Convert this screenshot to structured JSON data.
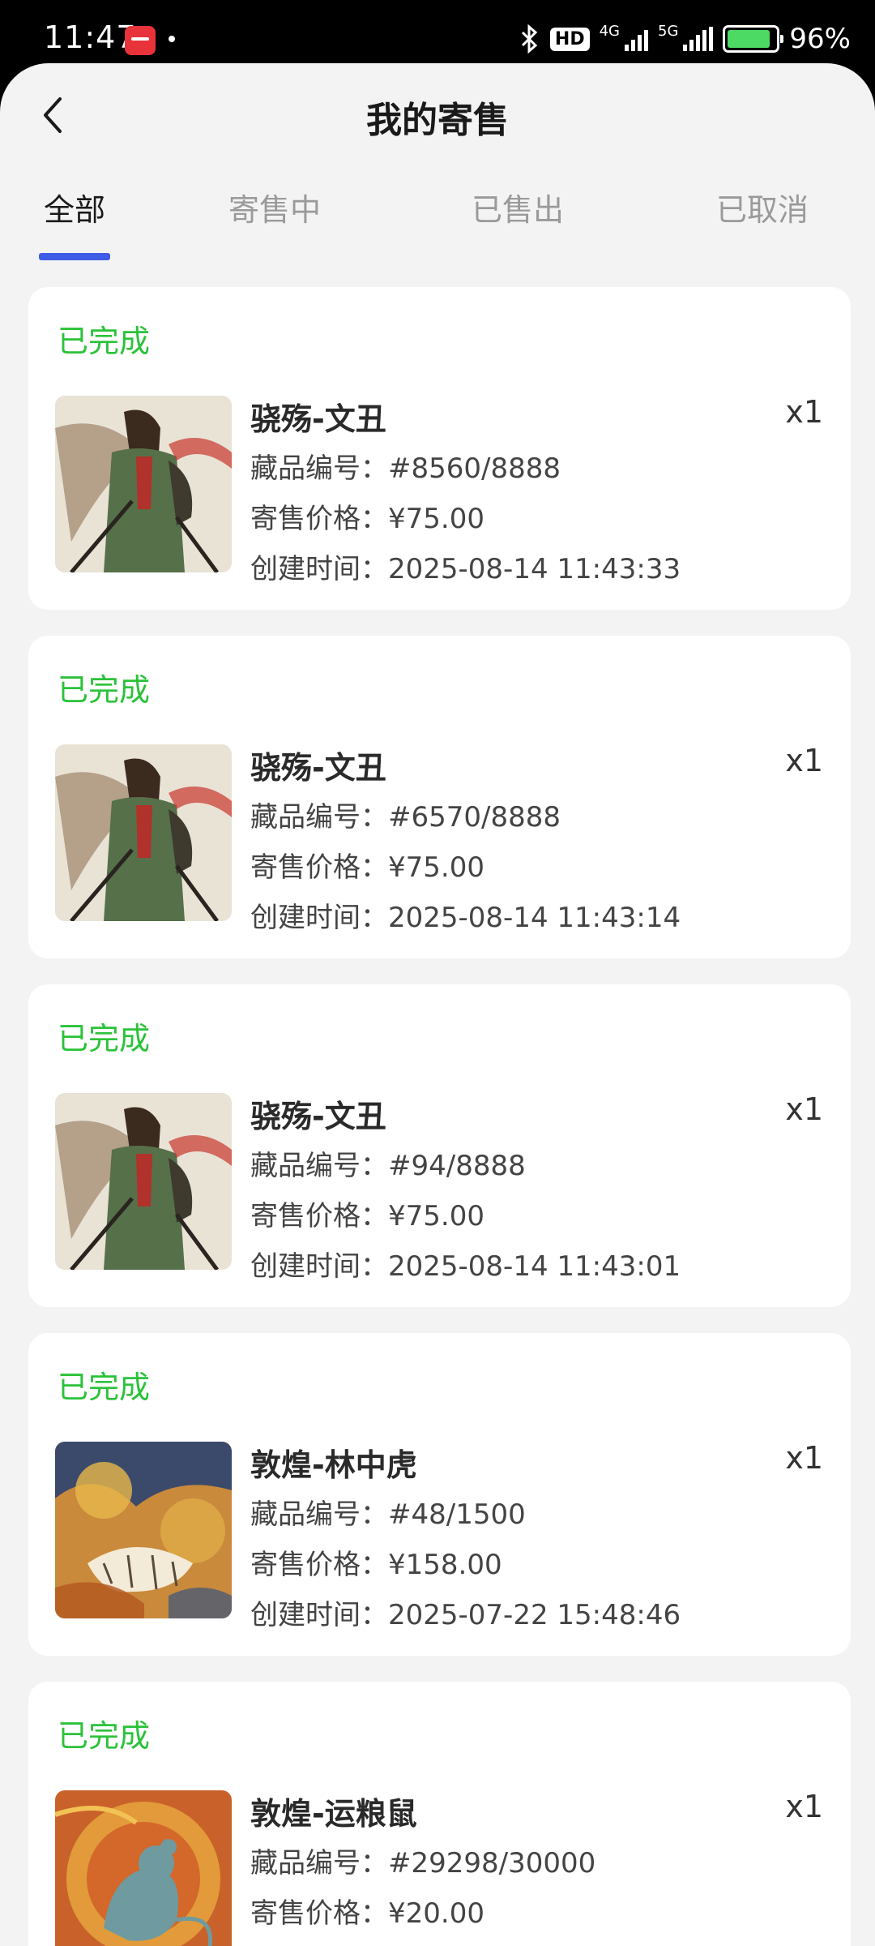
{
  "status_bar": {
    "time": "11:47",
    "hd": "HD",
    "net_1": "4G",
    "net_2": "5G",
    "battery_pct": "96%"
  },
  "header": {
    "title": "我的寄售",
    "back_icon": "chevron-left-icon"
  },
  "tabs": [
    {
      "label": "全部",
      "active": true
    },
    {
      "label": "寄售中",
      "active": false
    },
    {
      "label": "已售出",
      "active": false
    },
    {
      "label": "已取消",
      "active": false
    }
  ],
  "labels": {
    "serial": "藏品编号：",
    "price": "寄售价格：",
    "created": "创建时间："
  },
  "colors": {
    "accent": "#3e5ce6",
    "status_done": "#2bc23a",
    "background": "#f3f3f3"
  },
  "items": [
    {
      "status": "已完成",
      "name": "骁殇-文丑",
      "qty": "x1",
      "serial": "#8560/8888",
      "price": "¥75.00",
      "created": "2025-08-14 11:43:33",
      "thumb": "warrior-artwork"
    },
    {
      "status": "已完成",
      "name": "骁殇-文丑",
      "qty": "x1",
      "serial": "#6570/8888",
      "price": "¥75.00",
      "created": "2025-08-14 11:43:14",
      "thumb": "warrior-artwork"
    },
    {
      "status": "已完成",
      "name": "骁殇-文丑",
      "qty": "x1",
      "serial": "#94/8888",
      "price": "¥75.00",
      "created": "2025-08-14 11:43:01",
      "thumb": "warrior-artwork"
    },
    {
      "status": "已完成",
      "name": "敦煌-林中虎",
      "qty": "x1",
      "serial": "#48/1500",
      "price": "¥158.00",
      "created": "2025-07-22 15:48:46",
      "thumb": "tiger-artwork"
    },
    {
      "status": "已完成",
      "name": "敦煌-运粮鼠",
      "qty": "x1",
      "serial": "#29298/30000",
      "price": "¥20.00",
      "created": "",
      "thumb": "rat-artwork"
    }
  ]
}
